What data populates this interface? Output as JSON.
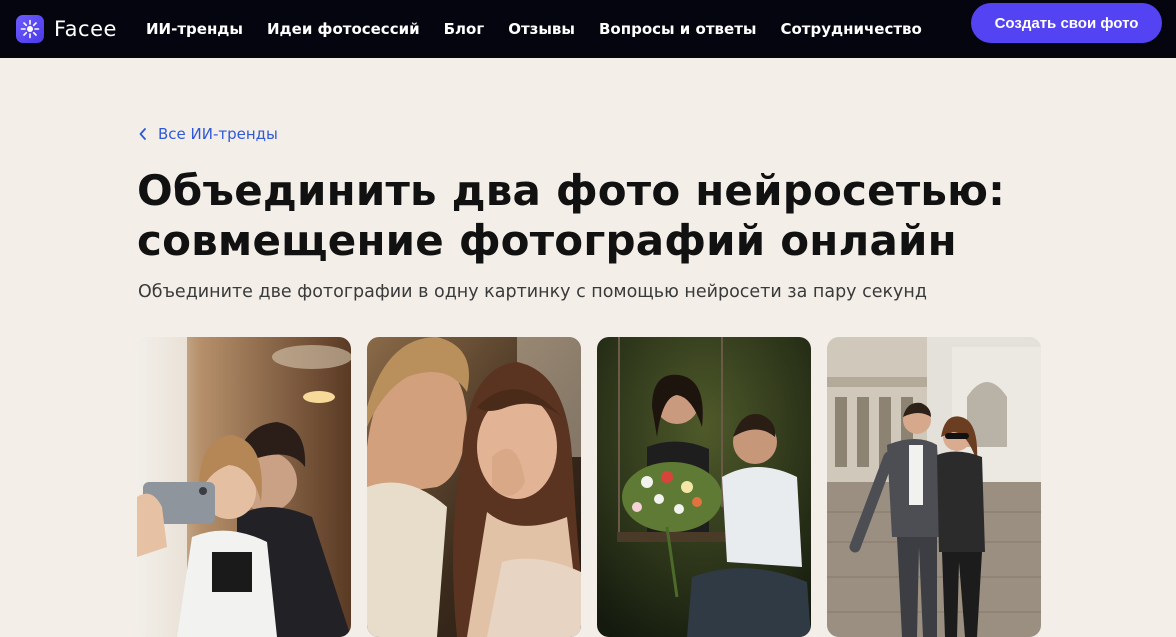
{
  "header": {
    "logo_text": "Facee",
    "nav": [
      {
        "label": "ИИ-тренды"
      },
      {
        "label": "Идеи фотосессий"
      },
      {
        "label": "Блог"
      },
      {
        "label": "Отзывы"
      },
      {
        "label": "Вопросы и ответы"
      },
      {
        "label": "Сотрудничество"
      }
    ],
    "cta_label": "Создать свои фото",
    "colors": {
      "bar": "#050510",
      "accent": "#5443f2"
    }
  },
  "breadcrumb": {
    "label": "Все ИИ-тренды",
    "icon": "chevron-left-icon",
    "color": "#2f59d8"
  },
  "page": {
    "title_line1": "Объединить два фото нейросетью:",
    "title_line2": "совмещение фотографий онлайн",
    "subtitle": "Объедините две фотографии в одну картинку с помощью нейросети за пару секунд"
  },
  "gallery": [
    {
      "scene": "couple-selfie-cafe"
    },
    {
      "scene": "couple-close-portrait"
    },
    {
      "scene": "couple-swing-bouquet"
    },
    {
      "scene": "couple-city-walk"
    }
  ]
}
